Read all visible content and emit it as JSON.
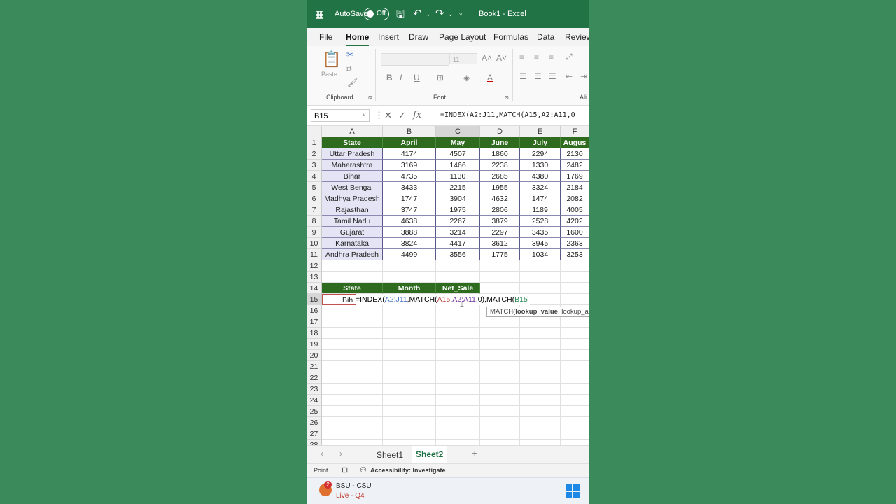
{
  "titlebar": {
    "autosave_label": "AutoSave",
    "autosave_state": "Off",
    "title": "Book1 - Excel"
  },
  "tabs": [
    "File",
    "Home",
    "Insert",
    "Draw",
    "Page Layout",
    "Formulas",
    "Data",
    "Review"
  ],
  "ribbon": {
    "paste_label": "Paste",
    "font_size": "11",
    "clipboard_label": "Clipboard",
    "font_label": "Font",
    "align_label": "Ali"
  },
  "formula_bar": {
    "name_box": "B15",
    "formula": "=INDEX(A2:J11,MATCH(A15,A2:A11,0"
  },
  "columns": [
    "A",
    "B",
    "C",
    "D",
    "E",
    "F"
  ],
  "rows": [
    "1",
    "2",
    "3",
    "4",
    "5",
    "6",
    "7",
    "8",
    "9",
    "10",
    "11",
    "12",
    "13",
    "14",
    "15",
    "16",
    "17",
    "18",
    "19",
    "20",
    "21",
    "22",
    "23",
    "24",
    "25",
    "26",
    "27",
    "28"
  ],
  "table": {
    "headers": [
      "State",
      "April",
      "May",
      "June",
      "July",
      "Augus"
    ],
    "rows": [
      [
        "Uttar Pradesh",
        "4174",
        "4507",
        "1860",
        "2294",
        "2130"
      ],
      [
        "Maharashtra",
        "3169",
        "1466",
        "2238",
        "1330",
        "2482"
      ],
      [
        "Bihar",
        "4735",
        "1130",
        "2685",
        "4380",
        "1769"
      ],
      [
        "West Bengal",
        "3433",
        "2215",
        "1955",
        "3324",
        "2184"
      ],
      [
        "Madhya Pradesh",
        "1747",
        "3904",
        "4632",
        "1474",
        "2082"
      ],
      [
        "Rajasthan",
        "3747",
        "1975",
        "2806",
        "1189",
        "4005"
      ],
      [
        "Tamil Nadu",
        "4638",
        "2267",
        "3879",
        "2528",
        "4202"
      ],
      [
        "Gujarat",
        "3888",
        "3214",
        "2297",
        "3435",
        "1600"
      ],
      [
        "Karnataka",
        "3824",
        "4417",
        "3612",
        "3945",
        "2363"
      ],
      [
        "Andhra Pradesh",
        "4499",
        "3556",
        "1775",
        "1034",
        "3253"
      ]
    ]
  },
  "lookup": {
    "headers": [
      "State",
      "Month",
      "Net_Sale"
    ],
    "state_value": "Bih",
    "editing_formula": [
      "=INDEX(",
      "A2:J11",
      ",MATCH(",
      "A15",
      ",",
      "A2:A11",
      ",0),MATCH(",
      "B15"
    ]
  },
  "tooltip": {
    "fn": "MATCH(",
    "arg": "lookup_value",
    "rest": ", lookup_a"
  },
  "sheets": [
    "Sheet1",
    "Sheet2"
  ],
  "status": {
    "mode": "Point",
    "accessibility": "Accessibility: Investigate"
  },
  "taskbar": {
    "badge": "2",
    "title": "BSU - CSU",
    "subtitle": "Live - Q4"
  },
  "colors": {
    "excel_green": "#217346",
    "header_green": "#2e6b1f",
    "ref_blue": "#4472c4",
    "ref_red": "#c0504d",
    "ref_purple": "#7030a0"
  }
}
